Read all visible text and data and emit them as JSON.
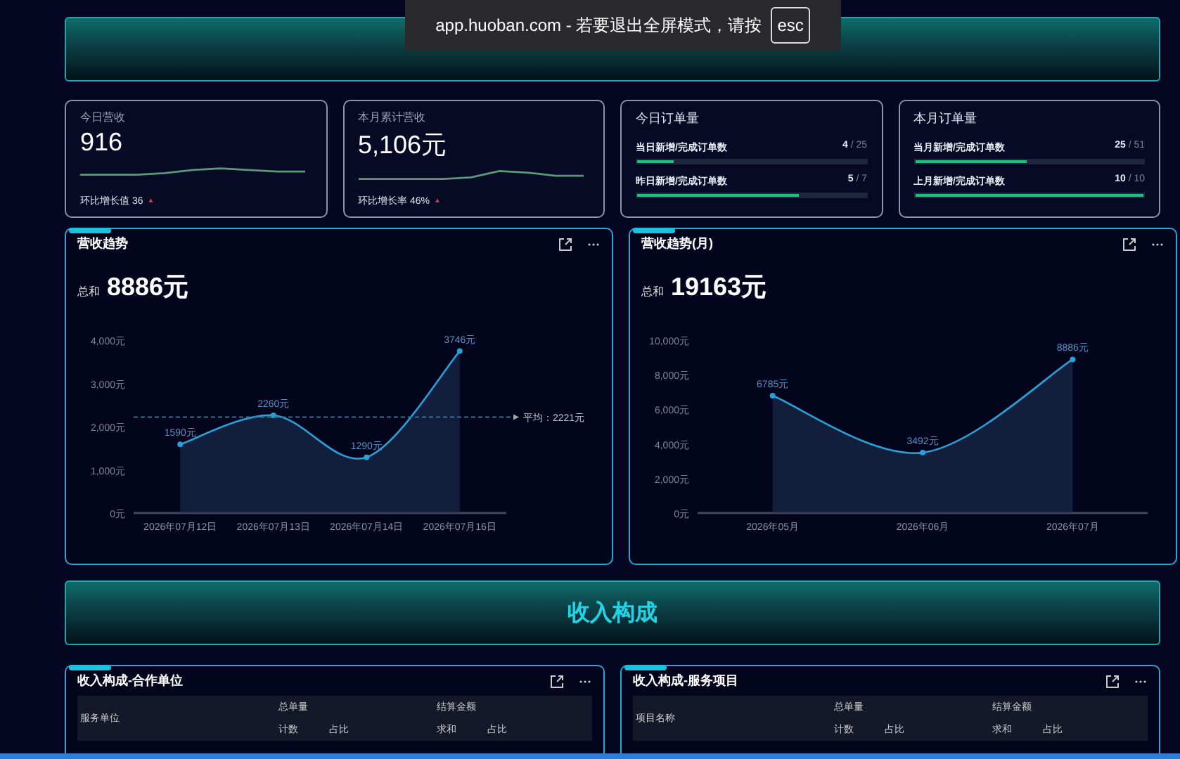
{
  "notification": {
    "text": "app.huoban.com - 若要退出全屏模式，请按",
    "key": "esc"
  },
  "kpis": [
    {
      "title": "今日营收",
      "value": "916",
      "note": "环比增长值 36",
      "arrow": "▲"
    },
    {
      "title": "本月累计营收",
      "value": "5,106元",
      "note": "环比增长率 46%",
      "arrow": "▲"
    }
  ],
  "order_cards": [
    {
      "title": "今日订单量",
      "rows": [
        {
          "label": "当日新增/完成订单数",
          "done": "4",
          "total": "/ 25",
          "level": 0.16
        },
        {
          "label": "昨日新增/完成订单数",
          "done": "5",
          "total": "/ 7",
          "level": 0.71
        }
      ]
    },
    {
      "title": "本月订单量",
      "rows": [
        {
          "label": "当月新增/完成订单数",
          "done": "25",
          "total": "/ 51",
          "level": 0.49
        },
        {
          "label": "上月新增/完成订单数",
          "done": "10",
          "total": "/ 10",
          "level": 1
        }
      ]
    }
  ],
  "charts": [
    {
      "title": "营收趋势",
      "sum_label": "总和",
      "sum": "8886元",
      "chart_data": {
        "type": "area",
        "categories": [
          "2026年07月12日",
          "2026年07月13日",
          "2026年07月14日",
          "2026年07月16日"
        ],
        "series": [
          {
            "color": "#2b9fd8",
            "values": [
              1590,
              2260,
              1290,
              3746
            ]
          }
        ],
        "ylim": [
          0,
          4000
        ],
        "yticks": [
          {
            "value": 0,
            "label": "0元"
          },
          {
            "value": 1000,
            "label": "1,000元"
          },
          {
            "value": 2000,
            "label": "2,000元"
          },
          {
            "value": 3000,
            "label": "3,000元"
          },
          {
            "value": 4000,
            "label": "4,000元"
          }
        ],
        "value_labels": [
          "1590元",
          "2260元",
          "1290元",
          "3746元"
        ],
        "ref_lines": [
          {
            "axis": "y",
            "value": 2221,
            "label": "平均：2221元"
          }
        ]
      }
    },
    {
      "title": "营收趋势(月)",
      "sum_label": "总和",
      "sum": "19163元",
      "chart_data": {
        "type": "area",
        "categories": [
          "2026年05月",
          "2026年06月",
          "2026年07月"
        ],
        "series": [
          {
            "color": "#2b9fd8",
            "values": [
              6785,
              3492,
              8886
            ]
          }
        ],
        "ylim": [
          0,
          10000
        ],
        "yticks": [
          {
            "value": 0,
            "label": "0元"
          },
          {
            "value": 2000,
            "label": "2,000元"
          },
          {
            "value": 4000,
            "label": "4,000元"
          },
          {
            "value": 6000,
            "label": "6,000元"
          },
          {
            "value": 8000,
            "label": "8,000元"
          },
          {
            "value": 10000,
            "label": "10,000元"
          }
        ],
        "value_labels": [
          "6785元",
          "3492元",
          "8886元"
        ]
      }
    }
  ],
  "section_title": "收入构成",
  "tables": [
    {
      "title": "收入构成-合作单位",
      "row_header": "服务单位",
      "groups": [
        {
          "label": "总单量",
          "columns": [
            "计数",
            "占比"
          ]
        },
        {
          "label": "结算金额",
          "columns": [
            "求和",
            "占比"
          ]
        }
      ]
    },
    {
      "title": "收入构成-服务项目",
      "row_header": "项目名称",
      "groups": [
        {
          "label": "总单量",
          "columns": [
            "计数",
            "占比"
          ]
        },
        {
          "label": "结算金额",
          "columns": [
            "求和",
            "占比"
          ]
        }
      ]
    }
  ]
}
